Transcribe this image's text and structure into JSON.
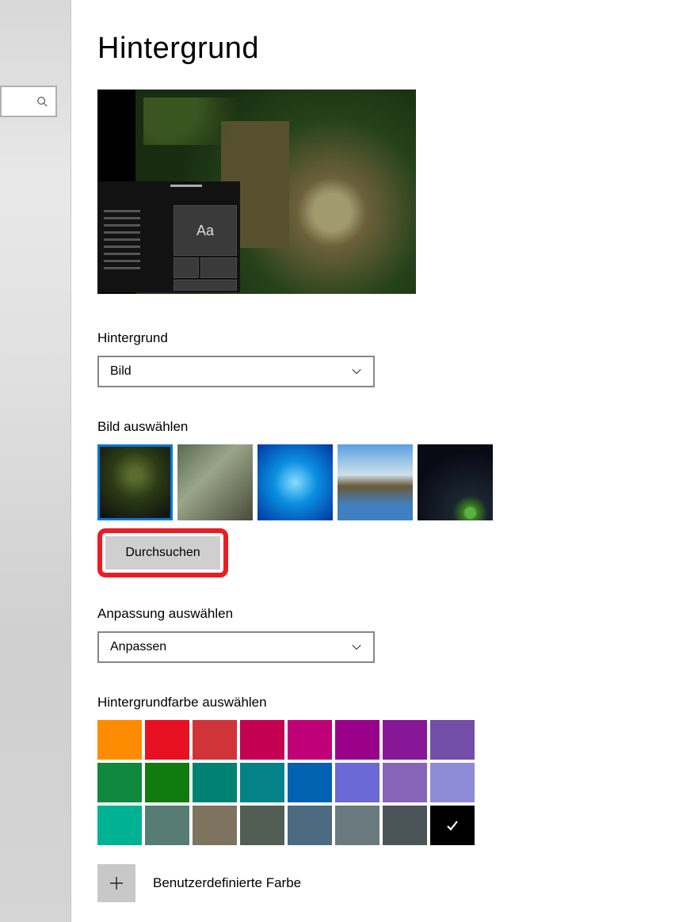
{
  "page": {
    "title": "Hintergrund"
  },
  "search": {
    "placeholder": ""
  },
  "preview": {
    "tile_text": "Aa"
  },
  "background_select": {
    "label": "Hintergrund",
    "value": "Bild"
  },
  "choose_image": {
    "label": "Bild auswählen",
    "browse_label": "Durchsuchen"
  },
  "fit_select": {
    "label": "Anpassung auswählen",
    "value": "Anpassen"
  },
  "background_color": {
    "label": "Hintergrundfarbe auswählen",
    "colors": [
      "#ff8c00",
      "#e81123",
      "#d13438",
      "#c30052",
      "#bf0077",
      "#9a0089",
      "#881798",
      "#744da9",
      "#10893e",
      "#107c10",
      "#008272",
      "#038387",
      "#0063b1",
      "#6b69d6",
      "#8764b8",
      "#8e8cd8",
      "#00b294",
      "#567c73",
      "#7e735f",
      "#525e54",
      "#4c6a82",
      "#69797e",
      "#4a5459",
      "#000000"
    ],
    "selected_index": 23,
    "custom_label": "Benutzerdefinierte Farbe"
  }
}
